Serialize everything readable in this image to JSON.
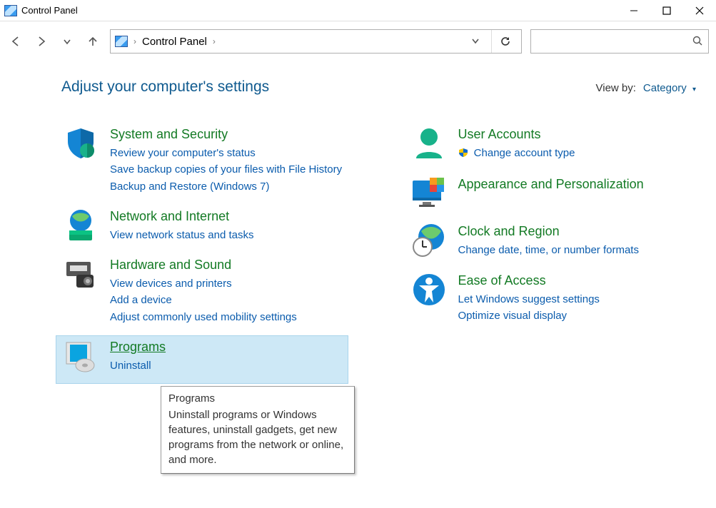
{
  "window": {
    "title": "Control Panel"
  },
  "address": {
    "location": "Control Panel"
  },
  "page": {
    "heading": "Adjust your computer's settings",
    "viewby_label": "View by:",
    "viewby_value": "Category"
  },
  "left": [
    {
      "title": "System and Security",
      "links": [
        "Review your computer's status",
        "Save backup copies of your files with File History",
        "Backup and Restore (Windows 7)"
      ]
    },
    {
      "title": "Network and Internet",
      "links": [
        "View network status and tasks"
      ]
    },
    {
      "title": "Hardware and Sound",
      "links": [
        "View devices and printers",
        "Add a device",
        "Adjust commonly used mobility settings"
      ]
    },
    {
      "title": "Programs",
      "links": [
        "Uninstall"
      ]
    }
  ],
  "right": [
    {
      "title": "User Accounts",
      "links": [
        "Change account type"
      ],
      "shield": [
        true
      ]
    },
    {
      "title": "Appearance and Personalization",
      "links": []
    },
    {
      "title": "Clock and Region",
      "links": [
        "Change date, time, or number formats"
      ]
    },
    {
      "title": "Ease of Access",
      "links": [
        "Let Windows suggest settings",
        "Optimize visual display"
      ]
    }
  ],
  "tooltip": {
    "title": "Programs",
    "body": "Uninstall programs or Windows features, uninstall gadgets, get new programs from the network or online, and more."
  }
}
